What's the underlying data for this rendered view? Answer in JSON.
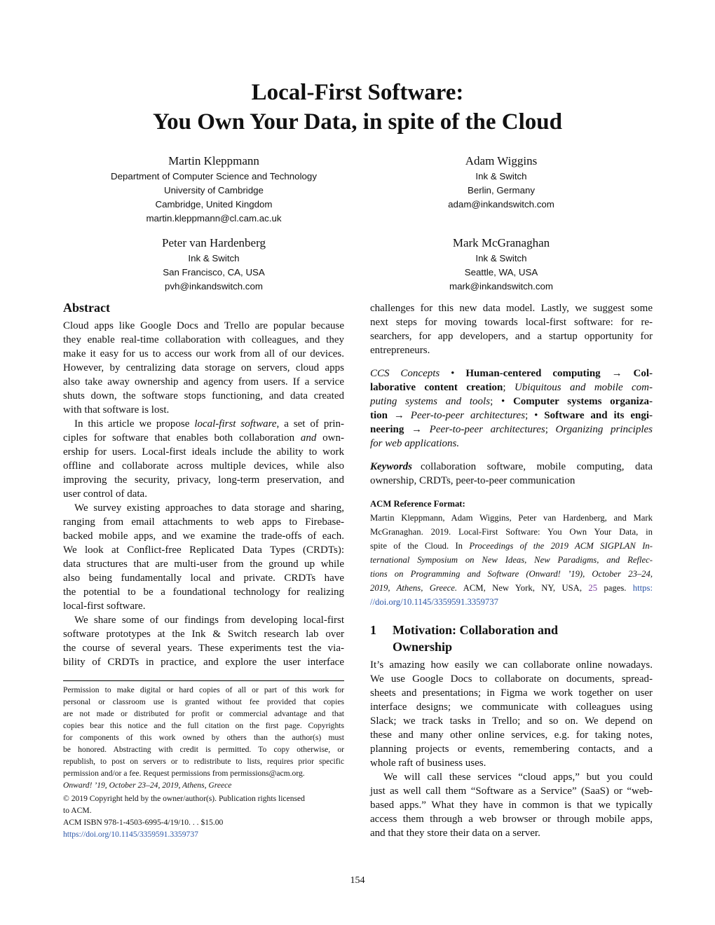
{
  "title": {
    "line1": "Local-First Software:",
    "line2": "You Own Your Data, in spite of the Cloud"
  },
  "authors": [
    {
      "name": "Martin Kleppmann",
      "lines": [
        "Department of Computer Science and Technology",
        "University of Cambridge",
        "Cambridge, United Kingdom",
        "martin.kleppmann@cl.cam.ac.uk"
      ]
    },
    {
      "name": "Adam Wiggins",
      "lines": [
        "Ink & Switch",
        "Berlin, Germany",
        "adam@inkandswitch.com"
      ]
    },
    {
      "name": "Peter van Hardenberg",
      "lines": [
        "Ink & Switch",
        "San Francisco, CA, USA",
        "pvh@inkandswitch.com"
      ]
    },
    {
      "name": "Mark McGranaghan",
      "lines": [
        "Ink & Switch",
        "Seattle, WA, USA",
        "mark@inkandswitch.com"
      ]
    }
  ],
  "abstract": {
    "heading": "Abstract",
    "p1": [
      "Cloud apps like Google Docs and Trello are popular because",
      "they enable real-time collaboration with colleagues, and they",
      "make it easy for us to access our work from all of our devices.",
      "However, by centralizing data storage on servers, cloud apps",
      "also take away ownership and agency from users. If a service",
      "shuts down, the software stops functioning, and data created",
      "with that software is lost."
    ],
    "p2_l1_pre": "In this article we propose ",
    "p2_l1_em": "local-first software",
    "p2_l1_post": ", a set of prin-",
    "p2_l2_pre": "ciples for software that enables both collaboration ",
    "p2_l2_em": "and",
    "p2_l2_post": " own-",
    "p2_rest": [
      "ership for users. Local-first ideals include the ability to work",
      "offline and collaborate across multiple devices, while also",
      "improving the security, privacy, long-term preservation, and",
      "user control of data."
    ],
    "p3": [
      "We survey existing approaches to data storage and sharing,",
      "ranging from email attachments to web apps to Firebase-",
      "backed mobile apps, and we examine the trade-offs of each.",
      "We look at Conflict-free Replicated Data Types (CRDTs):",
      "data structures that are multi-user from the ground up while",
      "also being fundamentally local and private. CRDTs have",
      "the potential to be a foundational technology for realizing",
      "local-first software."
    ],
    "p4": [
      "We share some of our findings from developing local-first",
      "software prototypes at the Ink & Switch research lab over",
      "the course of several years. These experiments test the via-",
      "bility of CRDTs in practice, and explore the user interface"
    ],
    "cont": [
      "challenges for this new data model. Lastly, we suggest some",
      "next steps for moving towards local-first software: for re-",
      "searchers, for app developers, and a startup opportunity for",
      "entrepreneurs."
    ]
  },
  "footnote": {
    "lines": [
      "Permission to make digital or hard copies of all or part of this work for",
      "personal or classroom use is granted without fee provided that copies",
      "are not made or distributed for profit or commercial advantage and that",
      "copies bear this notice and the full citation on the first page. Copyrights",
      "for components of this work owned by others than the author(s) must",
      "be honored. Abstracting with credit is permitted. To copy otherwise, or",
      "republish, to post on servers or to redistribute to lists, requires prior specific",
      "permission and/or a fee. Request permissions from permissions@acm.org."
    ],
    "venue": "Onward! ’19, October 23–24, 2019, Athens, Greece",
    "copyright1": "© 2019 Copyright held by the owner/author(s). Publication rights licensed",
    "copyright2": "to ACM.",
    "isbn": "ACM ISBN 978-1-4503-6995-4/19/10. . . $15.00",
    "doi": "https://doi.org/10.1145/3359591.3359737"
  },
  "ccs": {
    "label": "CCS Concepts",
    "l1_pre": " • ",
    "l1_b": "Human-centered computing → Col-",
    "l2_b": "laborative content creation",
    "l2_sep": "; ",
    "l2_em": "Ubiquitous and mobile com-",
    "l3_em": "puting systems and tools",
    "l3_sep": "; • ",
    "l3_b": "Computer systems organiza-",
    "l4_b1": "tion → ",
    "l4_em": "Peer-to-peer architectures",
    "l4_sep": "; • ",
    "l4_b2": "Software and its engi-",
    "l5_b": "neering → ",
    "l5_em1": "Peer-to-peer architectures",
    "l5_sep": "; ",
    "l5_em2": "Organizing principles",
    "l6_em": "for web applications."
  },
  "keywords": {
    "label": "Keywords",
    "l1": "collaboration software, mobile computing, data",
    "l2": "ownership, CRDTs, peer-to-peer communication"
  },
  "reference": {
    "heading": "ACM Reference Format:",
    "l1": "Martin Kleppmann, Adam Wiggins, Peter van Hardenberg, and Mark",
    "l2": "McGranaghan. 2019. Local-First Software: You Own Your Data, in",
    "l3_pre": "spite of the Cloud. In ",
    "l3_em": "Proceedings of the 2019 ACM SIGPLAN In-",
    "l4_em": "ternational Symposium on New Ideas, New Paradigms, and Reflec-",
    "l5_em": "tions on Programming and Software (Onward! ’19), October 23–24,",
    "l6_em": "2019, Athens, Greece.",
    "l6_post": " ACM, New York, NY, USA, ",
    "l6_pages": "25",
    "l6_pages_post": " pages. ",
    "l6_link": "https:",
    "l7_link": "//doi.org/10.1145/3359591.3359737"
  },
  "section1": {
    "number": "1",
    "title_l1": "Motivation: Collaboration and",
    "title_l2": "Ownership",
    "p1": [
      "It’s amazing how easily we can collaborate online nowadays.",
      "We use Google Docs to collaborate on documents, spread-",
      "sheets and presentations; in Figma we work together on user",
      "interface designs; we communicate with colleagues using",
      "Slack; we track tasks in Trello; and so on. We depend on",
      "these and many other online services, e.g. for taking notes,",
      "planning projects or events, remembering contacts, and a",
      "whole raft of business uses."
    ],
    "p2": [
      "We will call these services “cloud apps,” but you could",
      "just as well call them “Software as a Service” (SaaS) or “web-",
      "based apps.” What they have in common is that we typically",
      "access them through a web browser or through mobile apps,",
      "and that they store their data on a server."
    ]
  },
  "page_number": "154",
  "colors": {
    "link": "#2b55a6",
    "text": "#111111"
  }
}
